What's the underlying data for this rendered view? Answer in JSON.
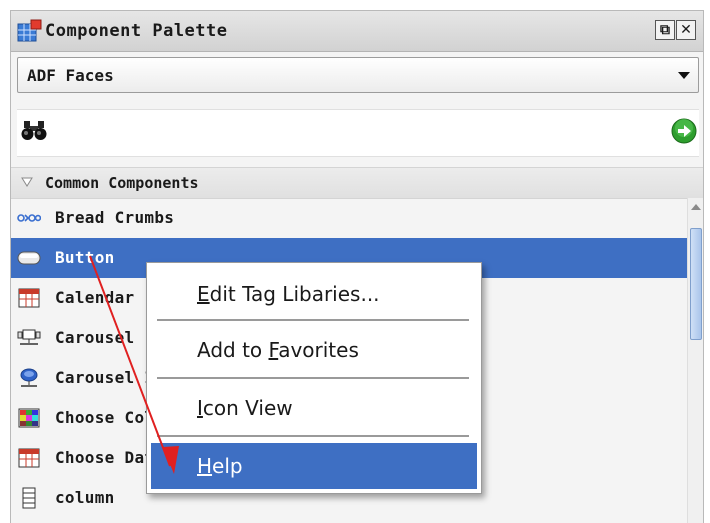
{
  "window": {
    "title": "Component Palette",
    "restore_glyph": "⧉",
    "close_glyph": "✕",
    "title_icon": "palette-grid-icon"
  },
  "library_select": {
    "value": "ADF Faces",
    "icon": "dropdown-arrow-icon"
  },
  "search": {
    "value": "",
    "placeholder": "",
    "icon": "binoculars-icon",
    "go_icon": "green-arrow-go-icon"
  },
  "category": {
    "label": "Common Components",
    "icon": "chevron-down-icon"
  },
  "components": [
    {
      "label": "Bread Crumbs",
      "icon": "breadcrumbs-icon",
      "selected": false
    },
    {
      "label": "Button",
      "icon": "button-icon",
      "selected": true
    },
    {
      "label": "Calendar",
      "icon": "calendar-icon",
      "selected": false
    },
    {
      "label": "Carousel",
      "icon": "carousel-icon",
      "selected": false
    },
    {
      "label": "Carousel Item",
      "icon": "carousel-item-icon",
      "selected": false
    },
    {
      "label": "Choose Color",
      "icon": "choose-color-icon",
      "selected": false
    },
    {
      "label": "Choose Date",
      "icon": "choose-date-icon",
      "selected": false
    },
    {
      "label": "column",
      "icon": "column-icon",
      "selected": false
    }
  ],
  "context_menu": {
    "items": [
      {
        "pre": "",
        "mn": "E",
        "post": "dit Tag Libaries...",
        "highlighted": false
      },
      {
        "pre": "Add to ",
        "mn": "F",
        "post": "avorites",
        "highlighted": false
      },
      {
        "pre": "",
        "mn": "I",
        "post": "con View",
        "highlighted": false
      },
      {
        "pre": "",
        "mn": "H",
        "post": "elp",
        "highlighted": true
      }
    ]
  },
  "colors": {
    "selection": "#3e6fc3",
    "annotation_arrow": "#e02020"
  }
}
